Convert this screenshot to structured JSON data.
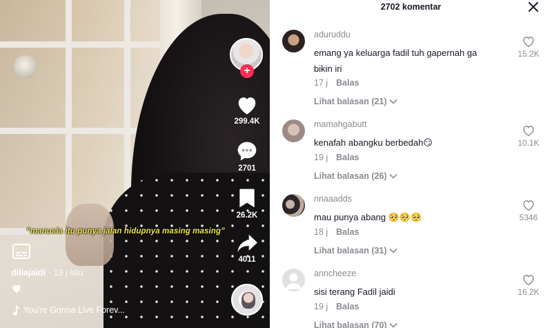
{
  "video": {
    "caption": "“manusia itu punya jalan hidupnya masing masing”",
    "author": "dillajaidi",
    "posted": "· 19 j lalu",
    "music": "You're Gonna Live Forev...",
    "actions": {
      "likes": "299.4K",
      "comments": "2701",
      "bookmarks": "26.2K",
      "shares": "4011"
    }
  },
  "comments_panel": {
    "title": "2702 komentar",
    "items": [
      {
        "username": "aduruddu",
        "text": "emang ya keluarga fadil tuh gapernah ga bikin iri",
        "time": "17 j",
        "reply_label": "Balas",
        "view_replies": "Lihat balasan (21)",
        "likes": "15.2K"
      },
      {
        "username": "mamahgabutt",
        "text": "kenafah abangku berbedah😏",
        "time": "19 j",
        "reply_label": "Balas",
        "view_replies": "Lihat balasan (26)",
        "likes": "10.1K"
      },
      {
        "username": "nnaaadds",
        "text": "mau punya abang 🥺🥺🥺",
        "time": "18 j",
        "reply_label": "Balas",
        "view_replies": "Lihat balasan (31)",
        "likes": "5346"
      },
      {
        "username": "anncheeze",
        "text": "sisi terang Fadil jaidi",
        "time": "19 j",
        "reply_label": "Balas",
        "view_replies": "Lihat balasan (70)",
        "likes": "16.2K"
      }
    ]
  },
  "colors": {
    "accent": "#fe2c55",
    "caption": "#f2e64b",
    "muted": "#8a8b91",
    "text": "#161823"
  }
}
